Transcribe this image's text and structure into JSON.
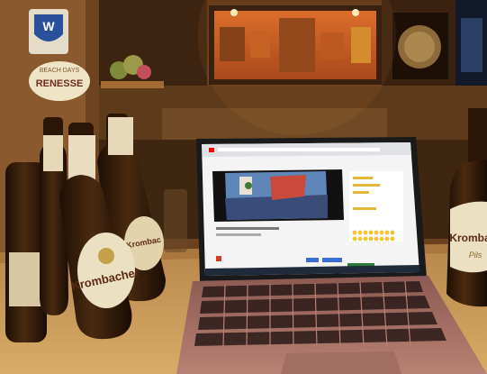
{
  "scene": {
    "description_free": true
  },
  "signs": {
    "renesse_top": "BEACH DAYS",
    "renesse_main": "RENESSE",
    "crest_letter": "W"
  },
  "bottles": {
    "brand": "Krombacher",
    "left_brand_fragment": "Krombac",
    "right_brand_fragment": "Kromba",
    "right_sub": "Pils",
    "front_brand": "Krombacher"
  },
  "laptop": {
    "screen_title": "YouTube"
  },
  "colors": {
    "wall": "#7a4a22",
    "table": "#c99a55",
    "laptop_body": "#b07a6a",
    "screen_bg": "#f4f4f4",
    "bottle": "#3a200d",
    "label": "#e9dcc0"
  }
}
